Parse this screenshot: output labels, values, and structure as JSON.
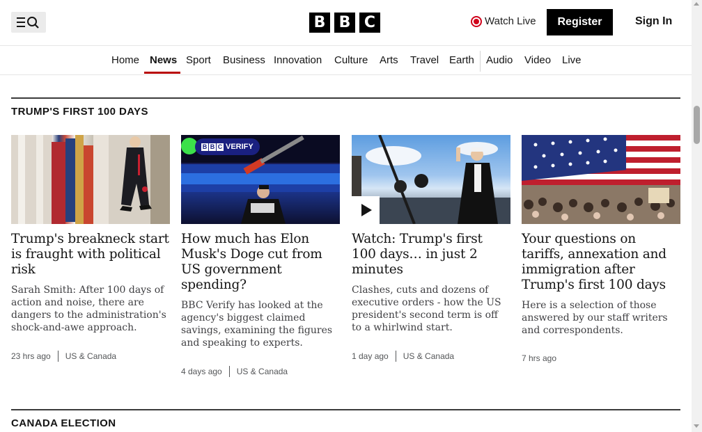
{
  "header": {
    "logo_letters": [
      "B",
      "B",
      "C"
    ],
    "watch_live": "Watch Live",
    "register": "Register",
    "sign_in": "Sign In"
  },
  "nav": {
    "items": [
      "Home",
      "News",
      "Sport",
      "Business",
      "Innovation",
      "Culture",
      "Arts",
      "Travel",
      "Earth",
      "Audio",
      "Video",
      "Live"
    ],
    "active": "News"
  },
  "colors": {
    "accent": "#b80000",
    "live": "#d0021b"
  },
  "sections": [
    {
      "title": "TRUMP'S FIRST 100 DAYS",
      "cards": [
        {
          "headline": "Trump's breakneck start is fraught with political risk",
          "summary": "Sarah Smith: After 100 days of action and noise, there are dangers to the administration's shock-and-awe approach.",
          "time": "23 hrs ago",
          "category": "US & Canada"
        },
        {
          "badge": "VERIFY",
          "badge_letters": [
            "B",
            "B",
            "C"
          ],
          "headline": "How much has Elon Musk's Doge cut from US government spending?",
          "summary": "BBC Verify has looked at the agency's biggest claimed savings, examining the figures and speaking to experts.",
          "time": "4 days ago",
          "category": "US & Canada"
        },
        {
          "headline": "Watch: Trump's first 100 days… in just 2 minutes",
          "summary": "Clashes, cuts and dozens of executive orders - how the US president's second term is off to a whirlwind start.",
          "time": "1 day ago",
          "category": "US & Canada"
        },
        {
          "headline": "Your questions on tariffs, annexation and immigration after Trump's first 100 days",
          "summary": "Here is a selection of those answered by our staff writers and correspondents.",
          "time": "7 hrs ago",
          "category": ""
        }
      ]
    },
    {
      "title": "CANADA ELECTION"
    }
  ]
}
